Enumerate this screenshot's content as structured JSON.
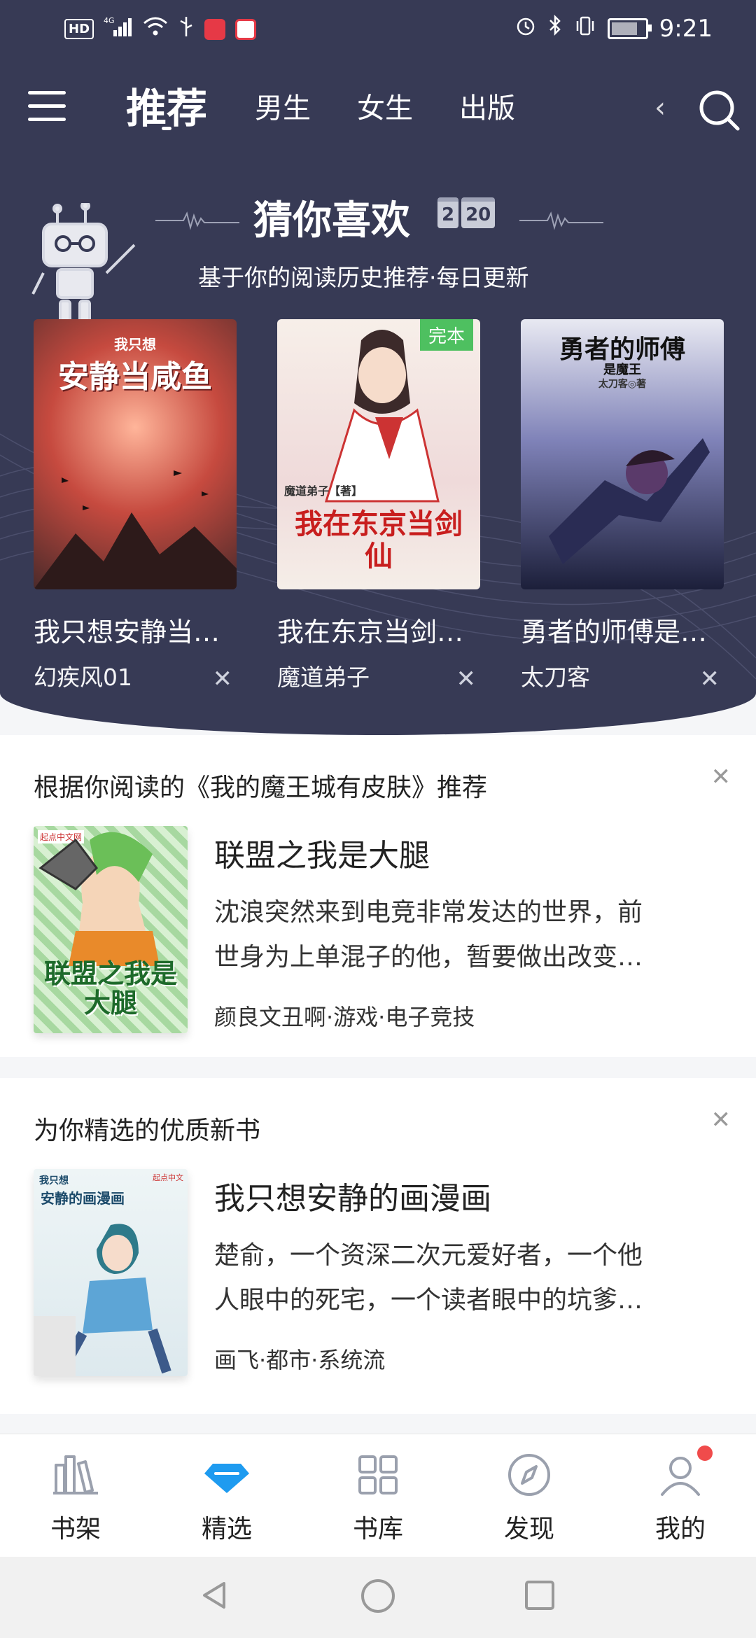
{
  "status_bar": {
    "hd_label": "HD",
    "network_label": "4G",
    "time": "9:21"
  },
  "top_nav": {
    "tabs": [
      {
        "label": "推荐",
        "active": true
      },
      {
        "label": "男生"
      },
      {
        "label": "女生"
      },
      {
        "label": "出版"
      }
    ]
  },
  "guess_section": {
    "title": "猜你喜欢",
    "date_month": "2",
    "date_day": "20",
    "subtitle": "基于你的阅读历史推荐·每日更新",
    "books": [
      {
        "title": "我只想安静当…",
        "author": "幻疾风01",
        "cover_title": "安静当咸鱼",
        "cover_top": "我只想",
        "cover_color": "#c64a3f"
      },
      {
        "title": "我在东京当剑…",
        "author": "魔道弟子",
        "cover_title": "我在东京当剑仙",
        "cover_author": "魔道弟子【著】",
        "badge": "完本",
        "cover_color": "#f1e6e3"
      },
      {
        "title": "勇者的师傅是…",
        "author": "太刀客",
        "cover_title": "勇者的师傅",
        "cover_sub": "是魔王",
        "cover_author": "太刀客◎著",
        "cover_color": "#3a3d6a"
      }
    ]
  },
  "rec_cards": [
    {
      "header": "根据你阅读的《我的魔王城有皮肤》推荐",
      "title": "联盟之我是大腿",
      "desc_line1": "沈浪突然来到电竞非常发达的世界，前",
      "desc_line2": "世身为上单混子的他，暂要做出改变…",
      "meta": "颜良文丑啊·游戏·电子竞技",
      "cover_text": "联盟之我是大腿",
      "cover_publisher": "起点中文网"
    },
    {
      "header": "为你精选的优质新书",
      "title": "我只想安静的画漫画",
      "desc_line1": "楚俞，一个资深二次元爱好者，一个他",
      "desc_line2": "人眼中的死宅，一个读者眼中的坑爹…",
      "meta": "画飞·都市·系统流",
      "cover_text": "安静的画漫画",
      "cover_top": "我只想",
      "cover_publisher": "起点中文"
    }
  ],
  "bottom_nav": [
    {
      "label": "书架",
      "icon": "bookshelf-icon"
    },
    {
      "label": "精选",
      "icon": "diamond-icon",
      "active": true
    },
    {
      "label": "书库",
      "icon": "grid-icon"
    },
    {
      "label": "发现",
      "icon": "compass-icon"
    },
    {
      "label": "我的",
      "icon": "user-icon"
    }
  ],
  "colors": {
    "header_bg": "#373a55",
    "accent_blue": "#1e9bf0",
    "badge_green": "#4ec060",
    "notify_red": "#f04b4b"
  }
}
